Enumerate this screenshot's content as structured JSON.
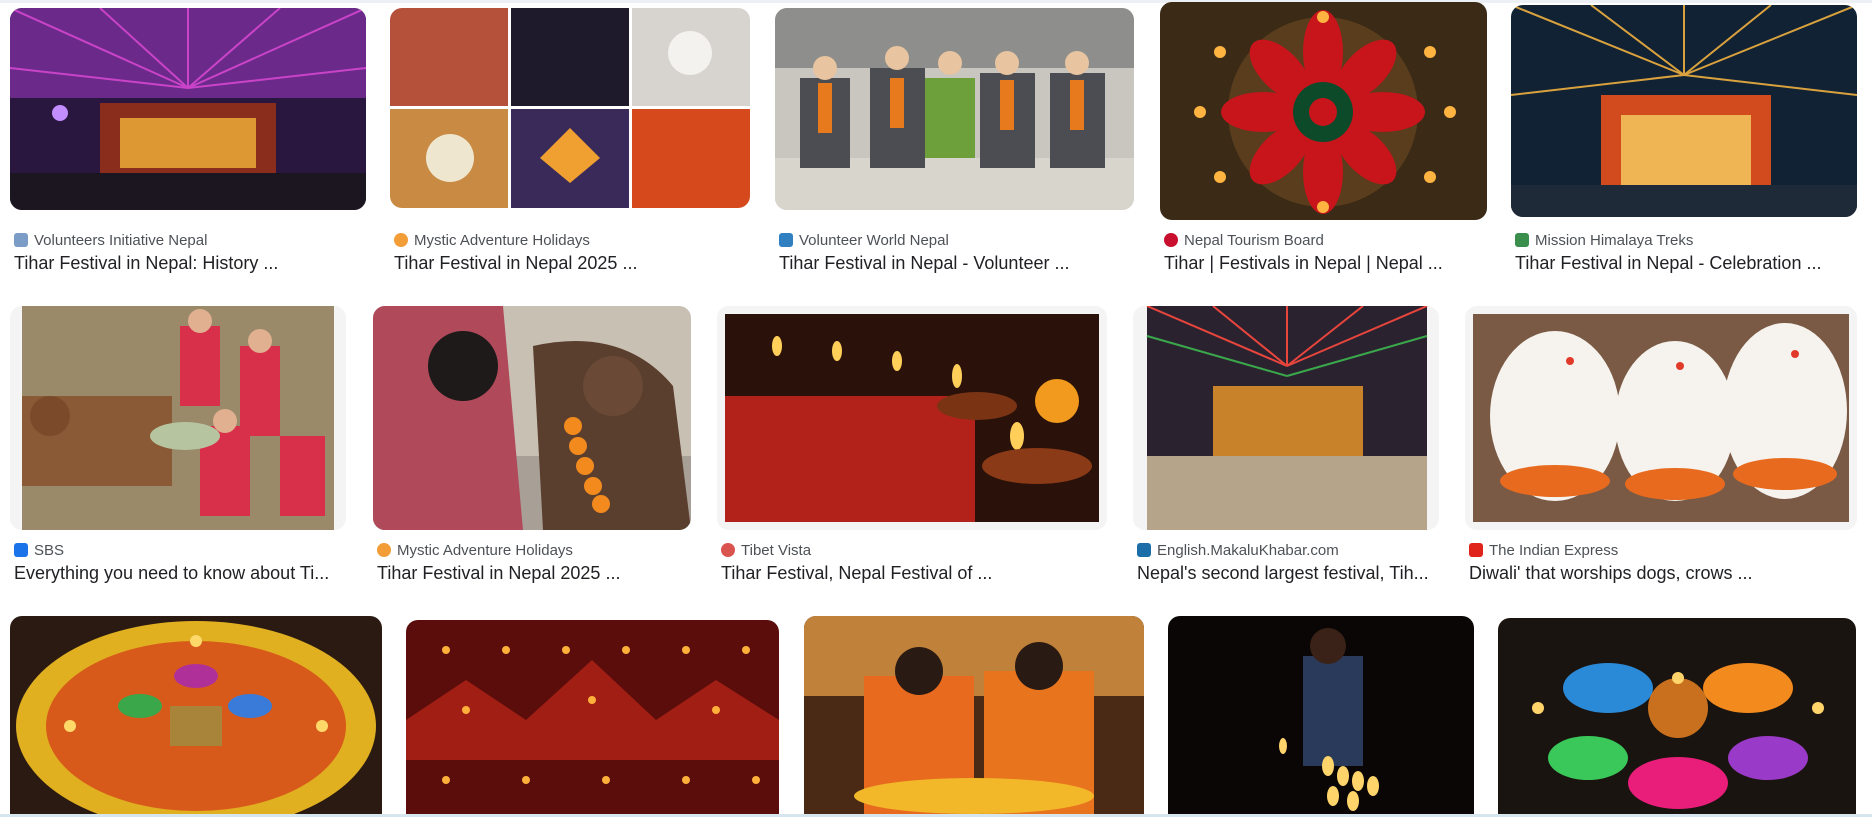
{
  "results": [
    {
      "source": "Volunteers Initiative Nepal",
      "title": "Tihar Festival in Nepal: History ...",
      "favicon_color": "#7a9cc6",
      "image": "Colorful flag-decorated temple at night"
    },
    {
      "source": "Mystic Adventure Holidays",
      "title": "Tihar Festival in Nepal 2025 ...",
      "favicon_color": "#f29d38",
      "image": "Collage of Tihar celebrations"
    },
    {
      "source": "Volunteer World Nepal",
      "title": "Tihar Festival in Nepal - Volunteer ...",
      "favicon_color": "#2f7fc1",
      "image": "Volunteers sitting with marigold garlands"
    },
    {
      "source": "Nepal Tourism Board",
      "title": "Tihar | Festivals in Nepal | Nepal ...",
      "favicon_color": "#c8102e",
      "image": "Red flower rangoli with oil lamps"
    },
    {
      "source": "Mission Himalaya Treks",
      "title": "Tihar Festival in Nepal - Celebration ...",
      "favicon_color": "#3a8f4d",
      "image": "Temple lit with string lights"
    },
    {
      "source": "SBS",
      "title": "Everything you need to know about Ti...",
      "favicon_color": "#1a73e8",
      "image": "Women worshipping a cow"
    },
    {
      "source": "Mystic Adventure Holidays",
      "title": "Tihar Festival in Nepal 2025 ...",
      "favicon_color": "#f29d38",
      "image": "Woman greeting a garlanded cow"
    },
    {
      "source": "Tibet Vista",
      "title": "Tihar Festival, Nepal Festival of ...",
      "favicon_color": "#d9534f",
      "image": "Oil lamps and flower petals"
    },
    {
      "source": "English.MakaluKhabar.com",
      "title": "Nepal's second largest festival, Tih...",
      "favicon_color": "#1b6ea8",
      "image": "Decorated street with flags"
    },
    {
      "source": "The Indian Express",
      "title": "Diwali' that worships dogs, crows ...",
      "favicon_color": "#e0241b",
      "image": "White dogs with marigold garlands"
    },
    {
      "source": "",
      "title": "",
      "favicon_color": "",
      "image": "Circular rangoli with diyas"
    },
    {
      "source": "",
      "title": "",
      "favicon_color": "",
      "image": "Rows of lit oil lamps"
    },
    {
      "source": "",
      "title": "",
      "favicon_color": "",
      "image": "Couple making a rangoli"
    },
    {
      "source": "",
      "title": "",
      "favicon_color": "",
      "image": "Woman lighting candles in the dark"
    },
    {
      "source": "",
      "title": "",
      "favicon_color": "",
      "image": "Colorful rangoli with diyas"
    }
  ]
}
